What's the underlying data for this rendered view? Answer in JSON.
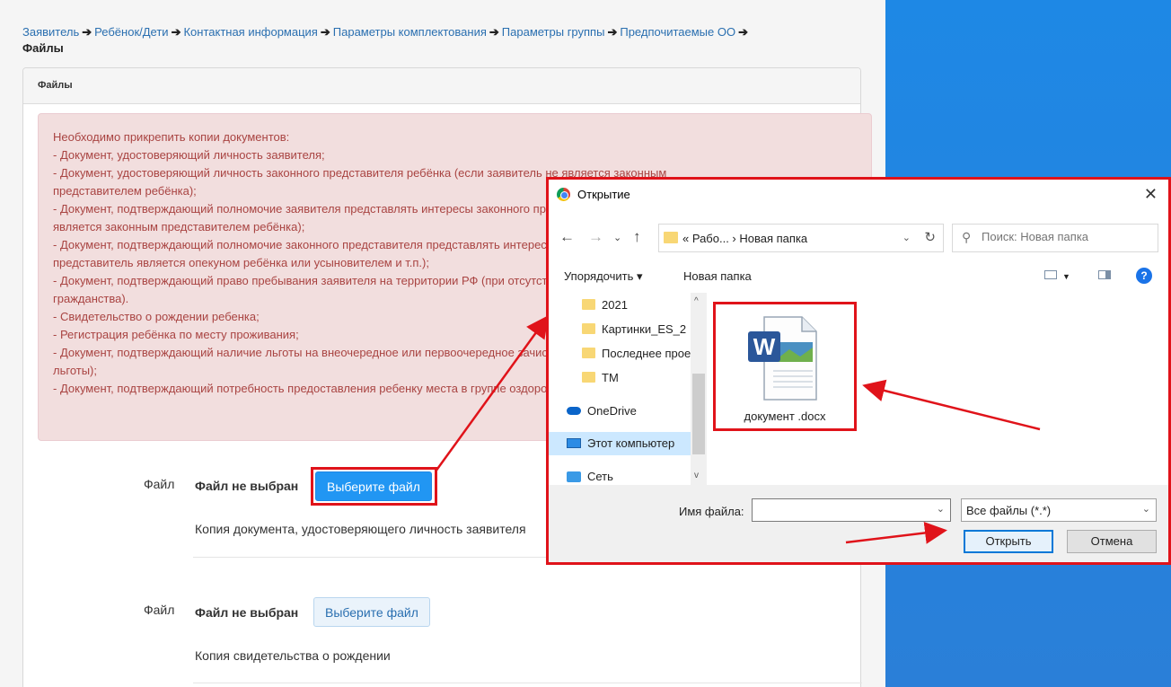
{
  "breadcrumb": {
    "items": [
      "Заявитель",
      "Ребёнок/Дети",
      "Контактная информация",
      "Параметры комплектования",
      "Параметры группы",
      "Предпочитаемые ОО"
    ],
    "separator": "➔",
    "current": "Файлы"
  },
  "panel": {
    "heading": "Файлы"
  },
  "alert": {
    "lines": [
      "Необходимо прикрепить копии документов:",
      "- Документ, удостоверяющий личность заявителя;",
      "- Документ, удостоверяющий личность законного представителя ребёнка (если заявитель не является законным",
      "представителем ребёнка);",
      "- Документ, подтверждающий полномочие заявителя представлять интересы законного представителя (если заявитель не",
      "является законным представителем ребёнка);",
      "- Документ, подтверждающий полномочие законного представителя представлять интересы ребёнка (если законный",
      "представитель является опекуном ребёнка или усыновителем и т.п.);",
      "- Документ, подтверждающий право пребывания заявителя на территории РФ (при отсутствии у заявителя российского",
      "гражданства).",
      "- Свидетельство о рождении ребенка;",
      "- Регистрация ребёнка по месту проживания;",
      "- Документ, подтверждающий наличие льготы на внеочередное или первоочередное зачисление ребёнка (при наличии",
      "льготы);",
      "- Документ, подтверждающий потребность предоставления ребенку места в группе оздоровительной направленности."
    ]
  },
  "uploads": [
    {
      "label": "Файл",
      "status": "Файл не выбран",
      "button": "Выберите файл",
      "description": "Копия документа, удостоверяющего личность заявителя"
    },
    {
      "label": "Файл",
      "status": "Файл не выбран",
      "button": "Выберите файл",
      "description": "Копия свидетельства о рождении"
    }
  ],
  "dialog": {
    "title": "Открытие",
    "close": "✕",
    "address": "«  Рабо...  ›  Новая папка",
    "search_placeholder": "Поиск: Новая папка",
    "toolbar": {
      "organize": "Упорядочить ▾",
      "new_folder": "Новая папка",
      "help": "?"
    },
    "nav_items": [
      "2021",
      "Картинки_ES_2",
      "Последнее проект",
      "TM",
      "OneDrive",
      "Этот компьютер",
      "Сеть"
    ],
    "file": {
      "name": "документ .docx",
      "icon": "word-document-icon"
    },
    "filename_label": "Имя файла:",
    "filename_value": "",
    "filetype": "Все файлы (*.*)",
    "open_button": "Открыть",
    "cancel_button": "Отмена"
  },
  "colors": {
    "accent": "#2196f3",
    "link": "#2a6fb0",
    "alert_bg": "#f2dede",
    "alert_text": "#a94442",
    "highlight_red": "#e0131a",
    "right_bg": "#1e88e5"
  }
}
